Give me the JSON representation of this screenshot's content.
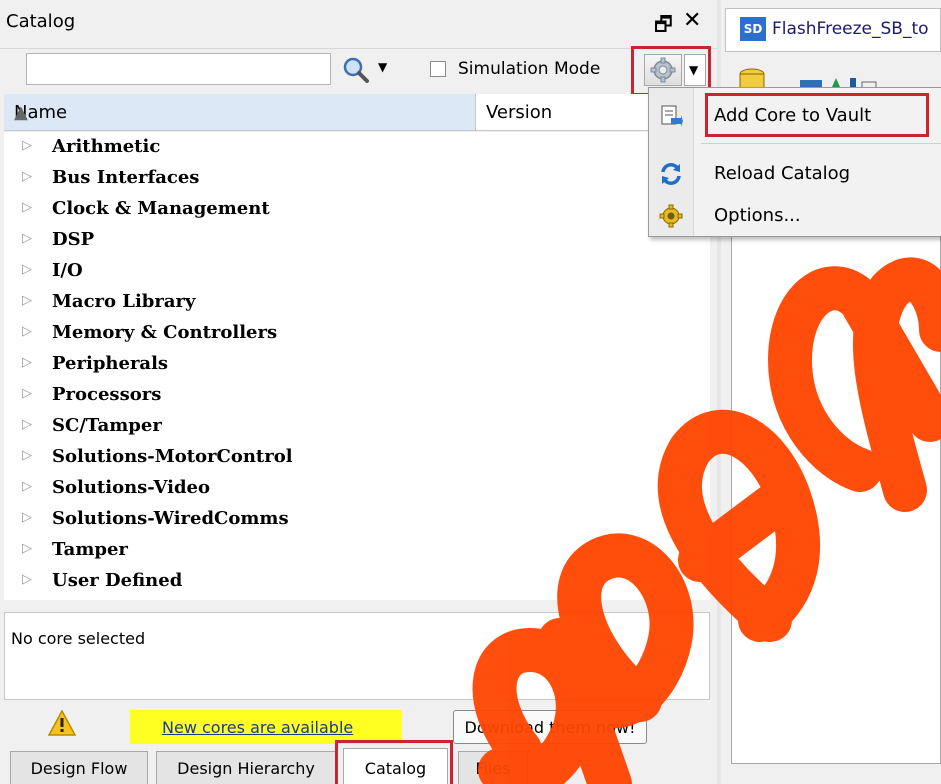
{
  "catalog": {
    "title": "Catalog",
    "search": {
      "value": "",
      "placeholder": ""
    },
    "simulation_mode": {
      "label": "Simulation Mode",
      "checked": false
    },
    "columns": {
      "name": "Name",
      "version": "Version"
    },
    "categories": [
      "Arithmetic",
      "Bus Interfaces",
      "Clock & Management",
      "DSP",
      "I/O",
      "Macro Library",
      "Memory & Controllers",
      "Peripherals",
      "Processors",
      "SC/Tamper",
      "Solutions-MotorControl",
      "Solutions-Video",
      "Solutions-WiredComms",
      "Tamper",
      "User Defined"
    ],
    "info_text": "No core selected",
    "new_cores_link": "New cores are available",
    "download_button": "Download them now!"
  },
  "bottom_tabs": [
    {
      "label": "Design Flow",
      "active": false
    },
    {
      "label": "Design Hierarchy",
      "active": false
    },
    {
      "label": "Catalog",
      "active": true
    },
    {
      "label": "Files",
      "active": false
    }
  ],
  "settings_menu": {
    "items": [
      {
        "label": "Add Core to Vault",
        "icon": "add-to-vault-icon"
      },
      {
        "label": "Reload Catalog",
        "icon": "reload-icon"
      },
      {
        "label": "Options...",
        "icon": "gear-icon"
      }
    ]
  },
  "right_panel": {
    "tab_icon_text": "SD",
    "tab_label": "FlashFreeze_SB_to"
  },
  "colors": {
    "highlight_box": "#c8262e",
    "new_cores_bg": "#ffff22",
    "link": "#1b3b8e",
    "header_selected": "#dde8f6",
    "watermark": "#ff4400"
  }
}
